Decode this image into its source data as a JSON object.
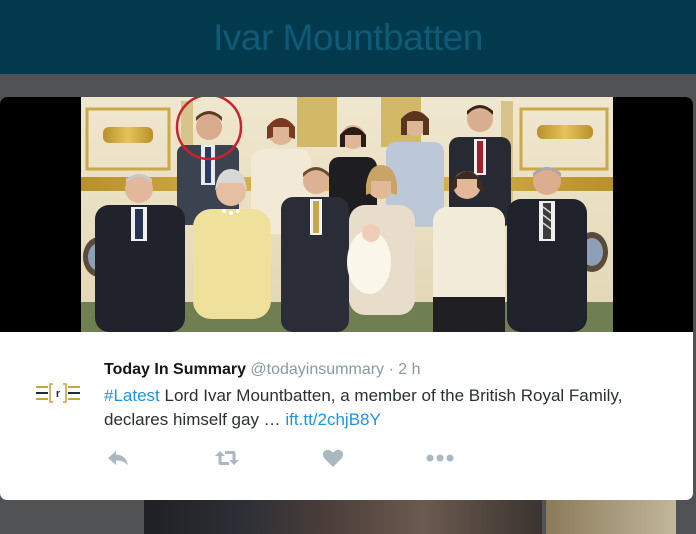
{
  "page": {
    "title": "Ivar Mountbatten"
  },
  "tweet": {
    "author_name": "Today In Summary",
    "author_handle": "@todayinsummary",
    "separator": " · ",
    "time": "2 h",
    "hashtag": "#Latest",
    "text_body": " Lord Ivar Mountbatten, a member of the British Royal Family, declares himself gay … ",
    "link_text": "ift.tt/2chjB8Y"
  },
  "actions": {
    "icons": [
      "reply-icon",
      "retweet-icon",
      "like-icon",
      "more-icon"
    ]
  },
  "colors": {
    "header_bg": "#02394c",
    "title": "#0f5a74",
    "link": "#1b95e0",
    "meta": "#8899a6",
    "action_icon": "#aab8c2"
  }
}
